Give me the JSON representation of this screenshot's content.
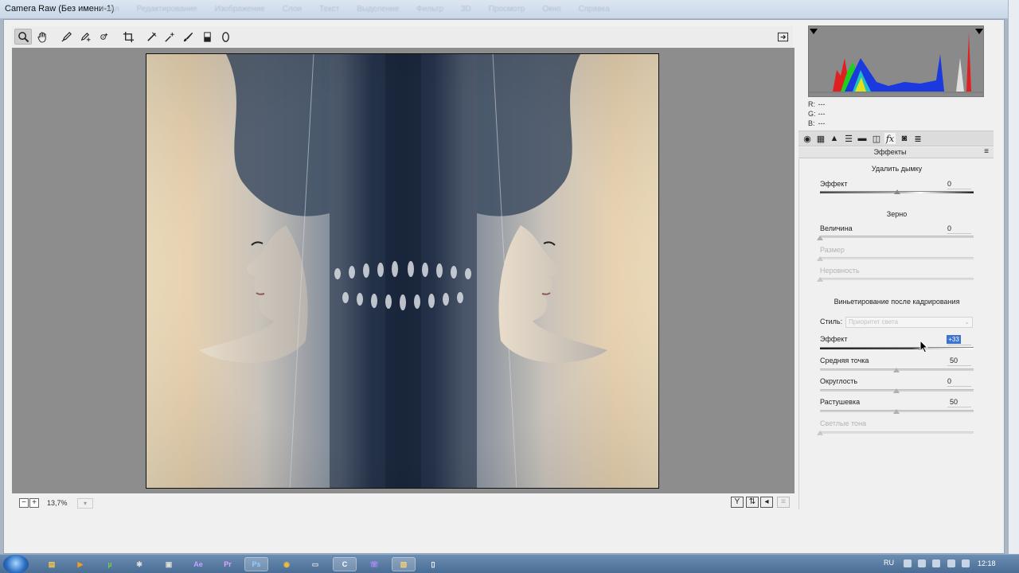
{
  "window": {
    "title": "Camera Raw (Без имени-1)",
    "ghost_menu": [
      "Файл",
      "Редактирование",
      "Изображение",
      "Слои",
      "Текст",
      "Выделение",
      "Фильтр",
      "3D",
      "Просмотр",
      "Окно",
      "Справка"
    ]
  },
  "toolbar": {
    "tools": [
      "zoom-tool",
      "hand-tool",
      "white-balance-tool",
      "color-sampler-tool",
      "targeted-adjustment-tool",
      "crop-tool",
      "straighten-tool",
      "spot-removal-tool",
      "red-eye-tool",
      "adjustment-brush-tool",
      "graduated-filter-tool",
      "radial-filter-tool"
    ],
    "open_preferences_icon": "preferences-icon"
  },
  "status": {
    "zoom": "13,7%",
    "zoom_arrow": "▾"
  },
  "histogram": {
    "r_label": "R:",
    "g_label": "G:",
    "b_label": "B:",
    "r_value": "---",
    "g_value": "---",
    "b_value": "---"
  },
  "panel": {
    "title": "Эффекты",
    "menu": "≡",
    "dehaze": {
      "section": "Удалить дымку",
      "label": "Эффект",
      "value": "0",
      "level": 0.5
    },
    "grain": {
      "section": "Зерно",
      "amount_label": "Величина",
      "amount_value": "0",
      "size_label": "Размер",
      "roughness_label": "Неровность"
    },
    "vignette": {
      "section": "Виньетирование после кадрирования",
      "style_label": "Стиль:",
      "style_value": "Приоритет света",
      "effect_label": "Эффект",
      "effect_value": "+33",
      "effect_level": 0.665,
      "midpoint_label": "Средняя точка",
      "midpoint_value": "50",
      "roundness_label": "Округлость",
      "roundness_value": "0",
      "feather_label": "Растушевка",
      "feather_value": "50",
      "highlights_label": "Светлые тона"
    }
  },
  "taskbar": {
    "apps": [
      "explorer",
      "media-player",
      "utorrent",
      "terminal",
      "Ae",
      "Pr",
      "Ps",
      "chrome",
      "app",
      "ccleaner",
      "viber",
      "folder",
      "notepad"
    ],
    "language": "RU",
    "time": "12:18"
  },
  "colors": {
    "accent_selection": "#3b74d0",
    "canvas_bg": "#8d8d8d",
    "panel_bg": "#f0f0f0"
  }
}
